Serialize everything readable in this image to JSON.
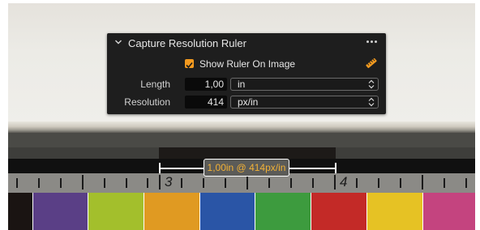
{
  "panel": {
    "title": "Capture Resolution Ruler",
    "show_ruler_label": "Show Ruler On Image",
    "show_ruler_checked": true,
    "length": {
      "label": "Length",
      "value": "1,00",
      "unit": "in"
    },
    "resolution": {
      "label": "Resolution",
      "value": "414",
      "unit": "px/in"
    },
    "icons": [
      "chevron-down-icon",
      "more-icon",
      "ruler-icon",
      "checkmark-icon",
      "up-down-arrows-icon"
    ]
  },
  "image": {
    "measurement_label": "1,00in @ 414px/in",
    "scale_numbers": [
      "3",
      "4"
    ],
    "patch_colors": [
      "#1a1412",
      "#5a3f86",
      "#a3bf2c",
      "#e09a22",
      "#2a55a6",
      "#3d9b3e",
      "#c32a27",
      "#e6c224",
      "#c4447f"
    ],
    "accent_color": "#f39a1f"
  }
}
